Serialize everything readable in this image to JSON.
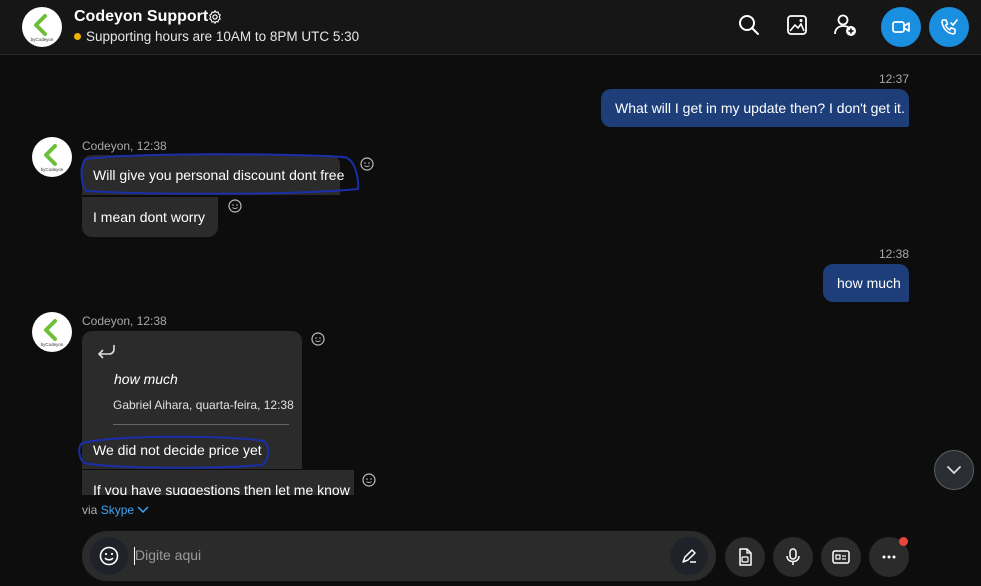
{
  "header": {
    "title": "Codeyon Support",
    "status": "Supporting hours are 10AM to 8PM UTC 5:30",
    "avatar_text": "byCodeyon",
    "icons": [
      "search-icon",
      "gallery-icon",
      "add-person-icon",
      "video-call-icon",
      "audio-call-icon"
    ]
  },
  "messages": {
    "out1": {
      "time": "12:37",
      "text": "What will I get in my update then? I don't get it."
    },
    "in1": {
      "meta": "Codeyon, 12:38",
      "text1": "Will give you personal discount dont free",
      "text2": "I mean dont worry"
    },
    "out2": {
      "time": "12:38",
      "text": "how much"
    },
    "in2": {
      "meta": "Codeyon, 12:38",
      "quote_text": "how much",
      "quote_author": "Gabriel Aihara, quarta-feira, 12:38",
      "reply_text": "We did not decide price yet",
      "next_text": "If you have suggestions then let me know"
    }
  },
  "footer": {
    "via": "via",
    "via_app": "Skype",
    "placeholder": "Digite aqui"
  },
  "colors": {
    "accent": "#1a8fe0",
    "outgoing_bubble": "#1d3e78",
    "incoming_bubble": "#2b2b2b",
    "status_dot": "#f0b400",
    "annotation_ink": "#1a2ea8",
    "notification_dot": "#e8453c"
  }
}
